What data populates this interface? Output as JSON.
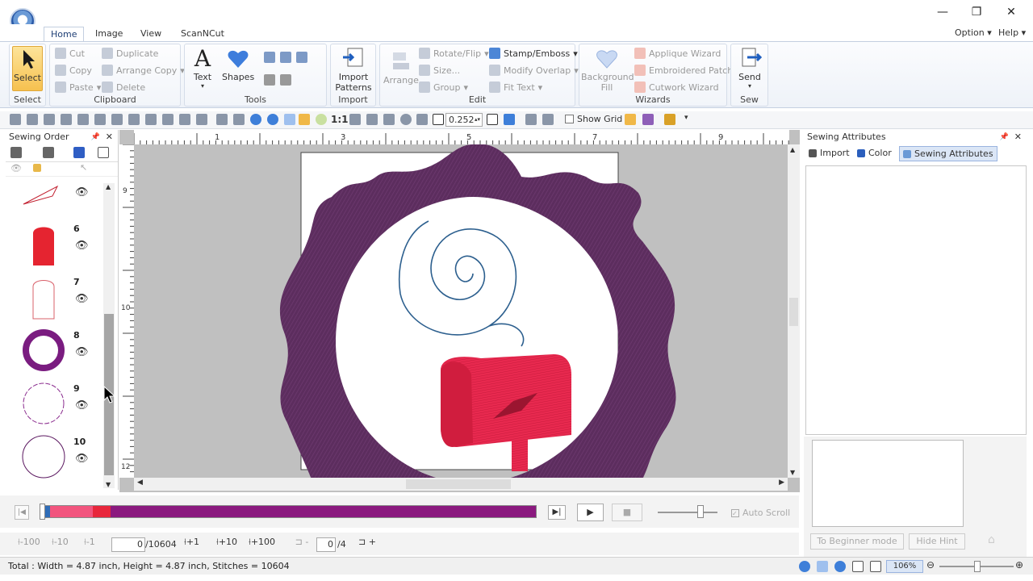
{
  "window": {
    "minimize": "—",
    "restore": "❐",
    "close": "✕"
  },
  "menu_right": {
    "option": "Option",
    "help": "Help"
  },
  "tabs": [
    "Home",
    "Image",
    "View",
    "ScanNCut"
  ],
  "ribbon": {
    "select": {
      "label": "Select",
      "group": "Select"
    },
    "clipboard": {
      "group": "Clipboard",
      "cut": "Cut",
      "copy": "Copy",
      "paste": "Paste",
      "duplicate": "Duplicate",
      "arrange_copy": "Arrange Copy",
      "delete": "Delete"
    },
    "tools": {
      "group": "Tools",
      "text": "Text",
      "shapes": "Shapes"
    },
    "import": {
      "group": "Import",
      "import_patterns_1": "Import",
      "import_patterns_2": "Patterns"
    },
    "edit": {
      "group": "Edit",
      "arrange": "Arrange",
      "rotate_flip": "Rotate/Flip",
      "size": "Size...",
      "group_btn": "Group",
      "stamp_emboss": "Stamp/Emboss",
      "modify_overlap": "Modify Overlap",
      "fit_text": "Fit Text"
    },
    "wizards": {
      "group": "Wizards",
      "background_fill_1": "Background",
      "background_fill_2": "Fill",
      "applique_wizard": "Applique Wizard",
      "embroidered_patch": "Embroidered Patch",
      "cutwork_wizard": "Cutwork Wizard"
    },
    "sew": {
      "group": "Sew",
      "send": "Send"
    }
  },
  "toolbar": {
    "ratio": "1:1",
    "zoom_value": "0.252",
    "show_grid": "Show Grid"
  },
  "sewing_order": {
    "title": "Sewing Order",
    "items": [
      {
        "num": "6"
      },
      {
        "num": "7"
      },
      {
        "num": "8"
      },
      {
        "num": "9"
      },
      {
        "num": "10"
      }
    ]
  },
  "ruler": {
    "top": [
      "1",
      "3",
      "5",
      "7",
      "9"
    ],
    "left": [
      "9",
      "10",
      "12"
    ]
  },
  "sewing_attributes": {
    "title": "Sewing Attributes",
    "tabs": [
      "Import",
      "Color",
      "Sewing Attributes"
    ],
    "beginner_mode": "To Beginner mode",
    "hide_hint": "Hide Hint"
  },
  "sequence": {
    "colors": [
      "#2f6db8",
      "#f2557e",
      "#e8273c",
      "#8b1a7f"
    ],
    "fractions": [
      0.015,
      0.086,
      0.036,
      0.863
    ],
    "auto_scroll": "Auto Scroll"
  },
  "steps": {
    "m100": "-100",
    "m10": "-10",
    "m1": "-1",
    "stitch_current": "0",
    "stitch_total": "/10604",
    "p1": "+1",
    "p10": "+10",
    "p100": "+100",
    "color_current": "0",
    "color_total": "/4"
  },
  "status": {
    "text": "Total : Width = 4.87 inch, Height = 4.87 inch, Stitches = 10604",
    "zoom": "106%"
  },
  "colors": {
    "frame": "#5c2d5e",
    "spiral": "#2c5f8e",
    "mailbox": "#e8294f"
  }
}
